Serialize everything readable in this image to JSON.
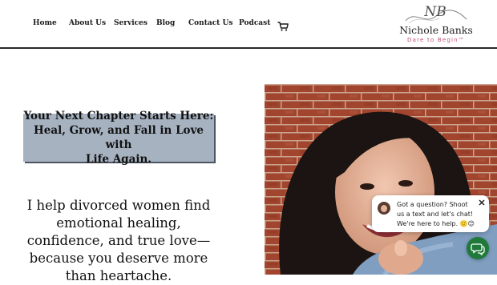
{
  "nav": {
    "items": [
      {
        "label": "Home"
      },
      {
        "label": "About Us"
      },
      {
        "label": "Services"
      },
      {
        "label": "Blog"
      },
      {
        "label": "Contact Us"
      },
      {
        "label": "Podcast"
      }
    ],
    "cart_icon": "cart-icon"
  },
  "logo": {
    "monogram": "NB",
    "name": "Nichole Banks",
    "tagline": "Dare to Begin™"
  },
  "hero": {
    "headline_lines": [
      "Your Next Chapter Starts Here:",
      "Heal, Grow, and Fall in Love with",
      "Life Again."
    ],
    "body_lines": [
      "I help divorced women find",
      "emotional healing,",
      "confidence, and true love—",
      "because you deserve more",
      "than heartache."
    ],
    "photo_icon": "woman-pointing-photo"
  },
  "chat": {
    "message": "Got a question? Shoot us a text and let's chat! We're here to help. 🙂😊",
    "close_icon": "close-icon",
    "launcher_icon": "chat-icon"
  },
  "colors": {
    "headline_bg": "#a7b2c1",
    "brand_pink": "#c2506e",
    "chat_green": "#1f7a3a",
    "brick": "#9b3f2c"
  }
}
